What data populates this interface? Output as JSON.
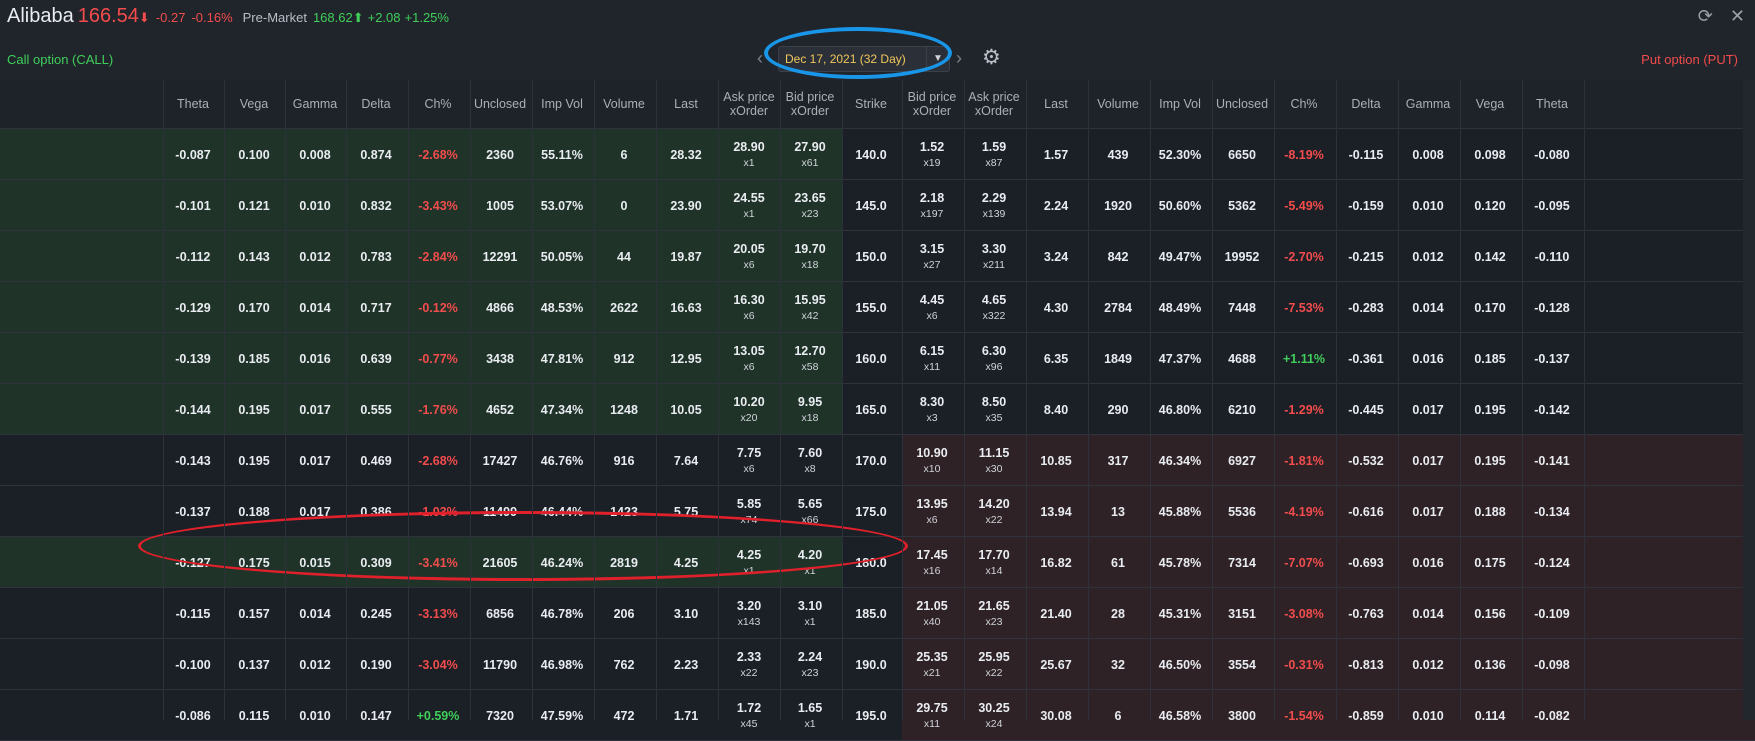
{
  "ticker": {
    "name": "Alibaba",
    "price": "166.54",
    "change": "-0.27",
    "change_pct": "-0.16%",
    "premarket_label": "Pre-Market",
    "premarket_price": "168.62",
    "premarket_change": "+2.08",
    "premarket_change_pct": "+1.25%"
  },
  "labels": {
    "call": "Call option  (CALL)",
    "put": "Put option  (PUT)"
  },
  "expiry": {
    "value": "Dec 17, 2021 (32 Day)"
  },
  "columns": {
    "call": [
      "Theta",
      "Vega",
      "Gamma",
      "Delta",
      "Ch%",
      "Unclosed",
      "Imp Vol",
      "Volume",
      "Last",
      "Ask price|xOrder",
      "Bid price|xOrder"
    ],
    "strike": "Strike",
    "put": [
      "Bid price|xOrder",
      "Ask price|xOrder",
      "Last",
      "Volume",
      "Imp Vol",
      "Unclosed",
      "Ch%",
      "Delta",
      "Gamma",
      "Vega",
      "Theta"
    ]
  },
  "rows": [
    {
      "strike": "140.0",
      "itm": true,
      "call": {
        "theta": "-0.087",
        "vega": "0.100",
        "gamma": "0.008",
        "delta": "0.874",
        "ch": "-2.68%",
        "unclosed": "2360",
        "iv": "55.11%",
        "volume": "6",
        "last": "28.32",
        "ask": "28.90",
        "askx": "x1",
        "bid": "27.90",
        "bidx": "x61"
      },
      "put": {
        "bid": "1.52",
        "bidx": "x19",
        "ask": "1.59",
        "askx": "x87",
        "last": "1.57",
        "volume": "439",
        "iv": "52.30%",
        "unclosed": "6650",
        "ch": "-8.19%",
        "delta": "-0.115",
        "gamma": "0.008",
        "vega": "0.098",
        "theta": "-0.080"
      }
    },
    {
      "strike": "145.0",
      "itm": true,
      "call": {
        "theta": "-0.101",
        "vega": "0.121",
        "gamma": "0.010",
        "delta": "0.832",
        "ch": "-3.43%",
        "unclosed": "1005",
        "iv": "53.07%",
        "volume": "0",
        "last": "23.90",
        "ask": "24.55",
        "askx": "x1",
        "bid": "23.65",
        "bidx": "x23"
      },
      "put": {
        "bid": "2.18",
        "bidx": "x197",
        "ask": "2.29",
        "askx": "x139",
        "last": "2.24",
        "volume": "1920",
        "iv": "50.60%",
        "unclosed": "5362",
        "ch": "-5.49%",
        "delta": "-0.159",
        "gamma": "0.010",
        "vega": "0.120",
        "theta": "-0.095"
      }
    },
    {
      "strike": "150.0",
      "itm": true,
      "call": {
        "theta": "-0.112",
        "vega": "0.143",
        "gamma": "0.012",
        "delta": "0.783",
        "ch": "-2.84%",
        "unclosed": "12291",
        "iv": "50.05%",
        "volume": "44",
        "last": "19.87",
        "ask": "20.05",
        "askx": "x6",
        "bid": "19.70",
        "bidx": "x18"
      },
      "put": {
        "bid": "3.15",
        "bidx": "x27",
        "ask": "3.30",
        "askx": "x211",
        "last": "3.24",
        "volume": "842",
        "iv": "49.47%",
        "unclosed": "19952",
        "ch": "-2.70%",
        "delta": "-0.215",
        "gamma": "0.012",
        "vega": "0.142",
        "theta": "-0.110"
      }
    },
    {
      "strike": "155.0",
      "itm": true,
      "call": {
        "theta": "-0.129",
        "vega": "0.170",
        "gamma": "0.014",
        "delta": "0.717",
        "ch": "-0.12%",
        "unclosed": "4866",
        "iv": "48.53%",
        "volume": "2622",
        "last": "16.63",
        "ask": "16.30",
        "askx": "x6",
        "bid": "15.95",
        "bidx": "x42"
      },
      "put": {
        "bid": "4.45",
        "bidx": "x6",
        "ask": "4.65",
        "askx": "x322",
        "last": "4.30",
        "volume": "2784",
        "iv": "48.49%",
        "unclosed": "7448",
        "ch": "-7.53%",
        "delta": "-0.283",
        "gamma": "0.014",
        "vega": "0.170",
        "theta": "-0.128"
      }
    },
    {
      "strike": "160.0",
      "itm": true,
      "call": {
        "theta": "-0.139",
        "vega": "0.185",
        "gamma": "0.016",
        "delta": "0.639",
        "ch": "-0.77%",
        "unclosed": "3438",
        "iv": "47.81%",
        "volume": "912",
        "last": "12.95",
        "ask": "13.05",
        "askx": "x6",
        "bid": "12.70",
        "bidx": "x58"
      },
      "put": {
        "bid": "6.15",
        "bidx": "x11",
        "ask": "6.30",
        "askx": "x96",
        "last": "6.35",
        "volume": "1849",
        "iv": "47.37%",
        "unclosed": "4688",
        "ch": "+1.11%",
        "delta": "-0.361",
        "gamma": "0.016",
        "vega": "0.185",
        "theta": "-0.137"
      }
    },
    {
      "strike": "165.0",
      "itm": true,
      "call": {
        "theta": "-0.144",
        "vega": "0.195",
        "gamma": "0.017",
        "delta": "0.555",
        "ch": "-1.76%",
        "unclosed": "4652",
        "iv": "47.34%",
        "volume": "1248",
        "last": "10.05",
        "ask": "10.20",
        "askx": "x20",
        "bid": "9.95",
        "bidx": "x18"
      },
      "put": {
        "bid": "8.30",
        "bidx": "x3",
        "ask": "8.50",
        "askx": "x35",
        "last": "8.40",
        "volume": "290",
        "iv": "46.80%",
        "unclosed": "6210",
        "ch": "-1.29%",
        "delta": "-0.445",
        "gamma": "0.017",
        "vega": "0.195",
        "theta": "-0.142"
      }
    },
    {
      "strike": "170.0",
      "itm": false,
      "call": {
        "theta": "-0.143",
        "vega": "0.195",
        "gamma": "0.017",
        "delta": "0.469",
        "ch": "-2.68%",
        "unclosed": "17427",
        "iv": "46.76%",
        "volume": "916",
        "last": "7.64",
        "ask": "7.75",
        "askx": "x6",
        "bid": "7.60",
        "bidx": "x8"
      },
      "put": {
        "bid": "10.90",
        "bidx": "x10",
        "ask": "11.15",
        "askx": "x30",
        "last": "10.85",
        "volume": "317",
        "iv": "46.34%",
        "unclosed": "6927",
        "ch": "-1.81%",
        "delta": "-0.532",
        "gamma": "0.017",
        "vega": "0.195",
        "theta": "-0.141"
      }
    },
    {
      "strike": "175.0",
      "itm": false,
      "call": {
        "theta": "-0.137",
        "vega": "0.188",
        "gamma": "0.017",
        "delta": "0.386",
        "ch": "-1.03%",
        "unclosed": "11499",
        "iv": "46.44%",
        "volume": "1423",
        "last": "5.75",
        "ask": "5.85",
        "askx": "x74",
        "bid": "5.65",
        "bidx": "x66"
      },
      "put": {
        "bid": "13.95",
        "bidx": "x6",
        "ask": "14.20",
        "askx": "x22",
        "last": "13.94",
        "volume": "13",
        "iv": "45.88%",
        "unclosed": "5536",
        "ch": "-4.19%",
        "delta": "-0.616",
        "gamma": "0.017",
        "vega": "0.188",
        "theta": "-0.134"
      }
    },
    {
      "strike": "180.0",
      "itm": false,
      "highlight": true,
      "call": {
        "theta": "-0.127",
        "vega": "0.175",
        "gamma": "0.015",
        "delta": "0.309",
        "ch": "-3.41%",
        "unclosed": "21605",
        "iv": "46.24%",
        "volume": "2819",
        "last": "4.25",
        "ask": "4.25",
        "askx": "x1",
        "bid": "4.20",
        "bidx": "x1"
      },
      "put": {
        "bid": "17.45",
        "bidx": "x16",
        "ask": "17.70",
        "askx": "x14",
        "last": "16.82",
        "volume": "61",
        "iv": "45.78%",
        "unclosed": "7314",
        "ch": "-7.07%",
        "delta": "-0.693",
        "gamma": "0.016",
        "vega": "0.175",
        "theta": "-0.124"
      }
    },
    {
      "strike": "185.0",
      "itm": false,
      "call": {
        "theta": "-0.115",
        "vega": "0.157",
        "gamma": "0.014",
        "delta": "0.245",
        "ch": "-3.13%",
        "unclosed": "6856",
        "iv": "46.78%",
        "volume": "206",
        "last": "3.10",
        "ask": "3.20",
        "askx": "x143",
        "bid": "3.10",
        "bidx": "x1"
      },
      "put": {
        "bid": "21.05",
        "bidx": "x40",
        "ask": "21.65",
        "askx": "x23",
        "last": "21.40",
        "volume": "28",
        "iv": "45.31%",
        "unclosed": "3151",
        "ch": "-3.08%",
        "delta": "-0.763",
        "gamma": "0.014",
        "vega": "0.156",
        "theta": "-0.109"
      }
    },
    {
      "strike": "190.0",
      "itm": false,
      "call": {
        "theta": "-0.100",
        "vega": "0.137",
        "gamma": "0.012",
        "delta": "0.190",
        "ch": "-3.04%",
        "unclosed": "11790",
        "iv": "46.98%",
        "volume": "762",
        "last": "2.23",
        "ask": "2.33",
        "askx": "x22",
        "bid": "2.24",
        "bidx": "x23"
      },
      "put": {
        "bid": "25.35",
        "bidx": "x21",
        "ask": "25.95",
        "askx": "x22",
        "last": "25.67",
        "volume": "32",
        "iv": "46.50%",
        "unclosed": "3554",
        "ch": "-0.31%",
        "delta": "-0.813",
        "gamma": "0.012",
        "vega": "0.136",
        "theta": "-0.098"
      }
    },
    {
      "strike": "195.0",
      "itm": false,
      "call": {
        "theta": "-0.086",
        "vega": "0.115",
        "gamma": "0.010",
        "delta": "0.147",
        "ch": "+0.59%",
        "unclosed": "7320",
        "iv": "47.59%",
        "volume": "472",
        "last": "1.71",
        "ask": "1.72",
        "askx": "x45",
        "bid": "1.65",
        "bidx": "x1"
      },
      "put": {
        "bid": "29.75",
        "bidx": "x11",
        "ask": "30.25",
        "askx": "x24",
        "last": "30.08",
        "volume": "6",
        "iv": "46.58%",
        "unclosed": "3800",
        "ch": "-1.54%",
        "delta": "-0.859",
        "gamma": "0.010",
        "vega": "0.114",
        "theta": "-0.082"
      }
    }
  ],
  "colors": {
    "background": "#1b1f26",
    "call_itm_bg": "#1f3329",
    "put_itm_bg": "#2e2226",
    "positive": "#3fcf5a",
    "negative": "#f24c4c",
    "expiry_text": "#f0c75a",
    "annotation_blue": "#1996e8",
    "annotation_red": "#e0202a"
  }
}
